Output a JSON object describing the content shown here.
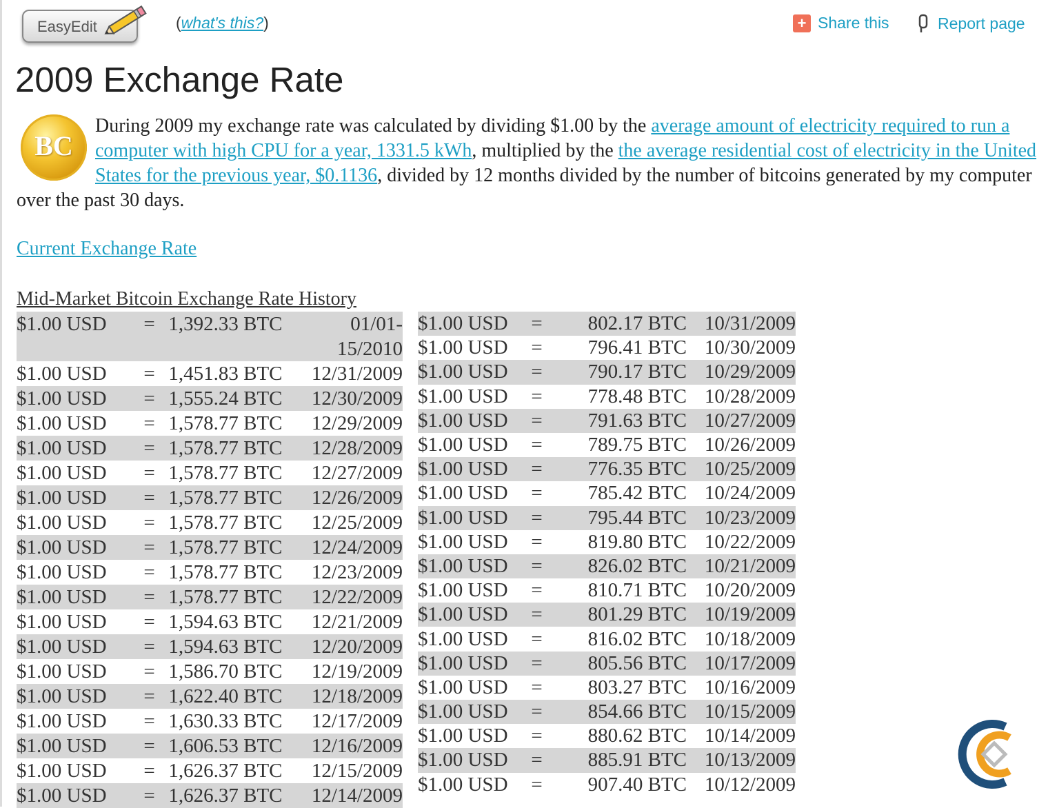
{
  "toolbar": {
    "easyedit_label": "EasyEdit",
    "whats_open": "(",
    "whats_link": "what's this?",
    "whats_close": ")",
    "share_label": "Share this",
    "report_label": "Report page"
  },
  "page": {
    "title": "2009 Exchange Rate",
    "coin_text": "BC",
    "intro_1": "During 2009 my exchange rate was calculated by dividing $1.00 by the ",
    "intro_link_1": "average amount of electricity required to run a computer with high CPU for a year, 1331.5 kWh",
    "intro_2": ", multiplied by the ",
    "intro_link_2": "the average residential cost of electricity in the United States for the previous year, $0.1136",
    "intro_3": ", divided by 12 months divided by the number of bitcoins generated by my computer over the past 30 days.",
    "current_link": "Current Exchange Rate",
    "history_title": "Mid-Market Bitcoin Exchange Rate History"
  },
  "left_rows": [
    {
      "usd": "$1.00 USD",
      "eq": "=",
      "btc": "1,392.33 BTC",
      "date": "01/01-\n15/2010"
    },
    {
      "usd": "$1.00 USD",
      "eq": "=",
      "btc": "1,451.83 BTC",
      "date": "12/31/2009"
    },
    {
      "usd": "$1.00 USD",
      "eq": "=",
      "btc": "1,555.24 BTC",
      "date": "12/30/2009"
    },
    {
      "usd": "$1.00 USD",
      "eq": "=",
      "btc": "1,578.77 BTC",
      "date": "12/29/2009"
    },
    {
      "usd": "$1.00 USD",
      "eq": "=",
      "btc": "1,578.77 BTC",
      "date": "12/28/2009"
    },
    {
      "usd": "$1.00 USD",
      "eq": "=",
      "btc": "1,578.77 BTC",
      "date": "12/27/2009"
    },
    {
      "usd": "$1.00 USD",
      "eq": "=",
      "btc": "1,578.77 BTC",
      "date": "12/26/2009"
    },
    {
      "usd": "$1.00 USD",
      "eq": "=",
      "btc": "1,578.77 BTC",
      "date": "12/25/2009"
    },
    {
      "usd": "$1.00 USD",
      "eq": "=",
      "btc": "1,578.77 BTC",
      "date": "12/24/2009"
    },
    {
      "usd": "$1.00 USD",
      "eq": "=",
      "btc": "1,578.77 BTC",
      "date": "12/23/2009"
    },
    {
      "usd": "$1.00 USD",
      "eq": "=",
      "btc": "1,578.77 BTC",
      "date": "12/22/2009"
    },
    {
      "usd": "$1.00 USD",
      "eq": "=",
      "btc": "1,594.63 BTC",
      "date": "12/21/2009"
    },
    {
      "usd": "$1.00 USD",
      "eq": "=",
      "btc": "1,594.63 BTC",
      "date": "12/20/2009"
    },
    {
      "usd": "$1.00 USD",
      "eq": "=",
      "btc": "1,586.70 BTC",
      "date": "12/19/2009"
    },
    {
      "usd": "$1.00 USD",
      "eq": "=",
      "btc": "1,622.40 BTC",
      "date": "12/18/2009"
    },
    {
      "usd": "$1.00 USD",
      "eq": "=",
      "btc": "1,630.33 BTC",
      "date": "12/17/2009"
    },
    {
      "usd": "$1.00 USD",
      "eq": "=",
      "btc": "1,606.53 BTC",
      "date": "12/16/2009"
    },
    {
      "usd": "$1.00 USD",
      "eq": "=",
      "btc": "1,626.37 BTC",
      "date": "12/15/2009"
    },
    {
      "usd": "$1.00 USD",
      "eq": "=",
      "btc": "1,626.37 BTC",
      "date": "12/14/2009"
    }
  ],
  "right_rows": [
    {
      "usd": "$1.00 USD",
      "eq": "=",
      "btc": "802.17 BTC",
      "date": "10/31/2009"
    },
    {
      "usd": "$1.00 USD",
      "eq": "=",
      "btc": "796.41 BTC",
      "date": "10/30/2009"
    },
    {
      "usd": "$1.00 USD",
      "eq": "=",
      "btc": "790.17 BTC",
      "date": "10/29/2009"
    },
    {
      "usd": "$1.00 USD",
      "eq": "=",
      "btc": "778.48 BTC",
      "date": "10/28/2009"
    },
    {
      "usd": "$1.00 USD",
      "eq": "=",
      "btc": "791.63 BTC",
      "date": "10/27/2009"
    },
    {
      "usd": "$1.00 USD",
      "eq": "=",
      "btc": "789.75 BTC",
      "date": "10/26/2009"
    },
    {
      "usd": "$1.00 USD",
      "eq": "=",
      "btc": "776.35 BTC",
      "date": "10/25/2009"
    },
    {
      "usd": "$1.00 USD",
      "eq": "=",
      "btc": "785.42 BTC",
      "date": "10/24/2009"
    },
    {
      "usd": "$1.00 USD",
      "eq": "=",
      "btc": "795.44 BTC",
      "date": "10/23/2009"
    },
    {
      "usd": "$1.00 USD",
      "eq": "=",
      "btc": "819.80 BTC",
      "date": "10/22/2009"
    },
    {
      "usd": "$1.00 USD",
      "eq": "=",
      "btc": "826.02 BTC",
      "date": "10/21/2009"
    },
    {
      "usd": "$1.00 USD",
      "eq": "=",
      "btc": "810.71 BTC",
      "date": "10/20/2009"
    },
    {
      "usd": "$1.00 USD",
      "eq": "=",
      "btc": "801.29 BTC",
      "date": "10/19/2009"
    },
    {
      "usd": "$1.00 USD",
      "eq": "=",
      "btc": "816.02 BTC",
      "date": "10/18/2009"
    },
    {
      "usd": "$1.00 USD",
      "eq": "=",
      "btc": "805.56 BTC",
      "date": "10/17/2009"
    },
    {
      "usd": "$1.00 USD",
      "eq": "=",
      "btc": "803.27 BTC",
      "date": "10/16/2009"
    },
    {
      "usd": "$1.00 USD",
      "eq": "=",
      "btc": "854.66 BTC",
      "date": "10/15/2009"
    },
    {
      "usd": "$1.00 USD",
      "eq": "=",
      "btc": "880.62 BTC",
      "date": "10/14/2009"
    },
    {
      "usd": "$1.00 USD",
      "eq": "=",
      "btc": "885.91 BTC",
      "date": "10/13/2009"
    },
    {
      "usd": "$1.00 USD",
      "eq": "=",
      "btc": "907.40 BTC",
      "date": "10/12/2009"
    }
  ],
  "icons": {
    "easyedit": "pencil-icon",
    "share": "plus-icon",
    "report": "flag-icon",
    "coin": "bitcoin-coin-icon",
    "corner": "brand-logo-icon"
  },
  "colors": {
    "link": "#1d9fc4",
    "row_shade": "#d6d6d6",
    "share_icon": "#f07058",
    "logo_blue": "#1f4f7a",
    "logo_orange": "#f0a020"
  }
}
